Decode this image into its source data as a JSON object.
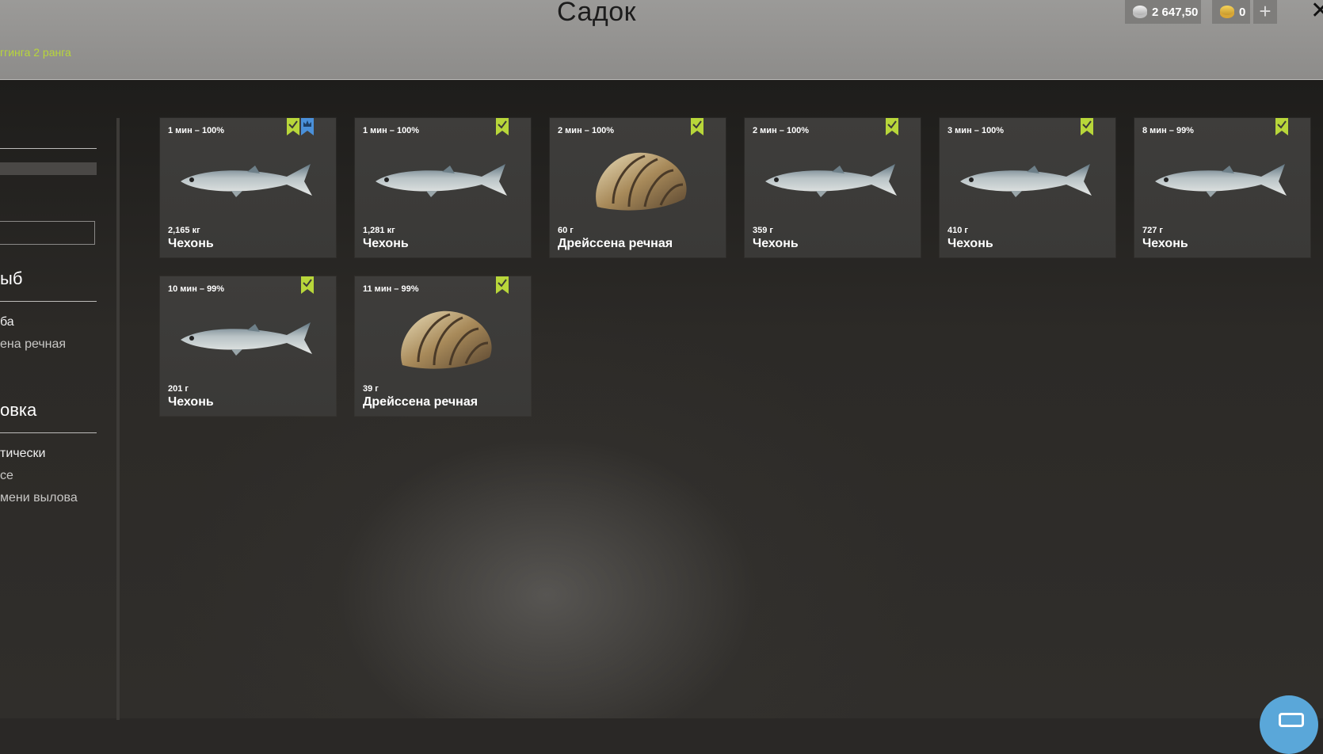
{
  "header": {
    "title": "Садок",
    "subtitle_link": "ггинга 2 ранга",
    "silver": "2 647,50",
    "gold": "0",
    "plus_label": "+",
    "close_label": "✕"
  },
  "sidebar": {
    "section_fish_heading": "ыб",
    "fish_items": [
      "ба",
      "ена речная"
    ],
    "section_sort_heading": "овка",
    "sort_items": [
      "тически",
      "се",
      "мени вылова"
    ]
  },
  "catches": [
    {
      "time": "1 мин – 100%",
      "weight": "2,165 кг",
      "name": "Чехонь",
      "kind": "fish",
      "trophy": true
    },
    {
      "time": "1 мин – 100%",
      "weight": "1,281 кг",
      "name": "Чехонь",
      "kind": "fish",
      "trophy": false
    },
    {
      "time": "2 мин – 100%",
      "weight": "60 г",
      "name": "Дрейссена речная",
      "kind": "shell",
      "trophy": false
    },
    {
      "time": "2 мин – 100%",
      "weight": "359 г",
      "name": "Чехонь",
      "kind": "fish",
      "trophy": false
    },
    {
      "time": "3 мин – 100%",
      "weight": "410 г",
      "name": "Чехонь",
      "kind": "fish",
      "trophy": false
    },
    {
      "time": "8 мин – 99%",
      "weight": "727 г",
      "name": "Чехонь",
      "kind": "fish",
      "trophy": false
    },
    {
      "time": "10 мин – 99%",
      "weight": "201 г",
      "name": "Чехонь",
      "kind": "fish",
      "trophy": false
    },
    {
      "time": "11 мин – 99%",
      "weight": "39 г",
      "name": "Дрейссена речная",
      "kind": "shell",
      "trophy": false
    }
  ],
  "colors": {
    "accent_green": "#b8d63a",
    "badge_blue": "#4a90d9",
    "chat_blue": "#5aa7d9"
  },
  "icons": {
    "silver": "silver-coin-icon",
    "gold": "gold-coin-icon",
    "keep": "checkmark-bookmark-icon",
    "trophy": "crown-bookmark-icon",
    "chat": "chat-bubble-icon"
  }
}
